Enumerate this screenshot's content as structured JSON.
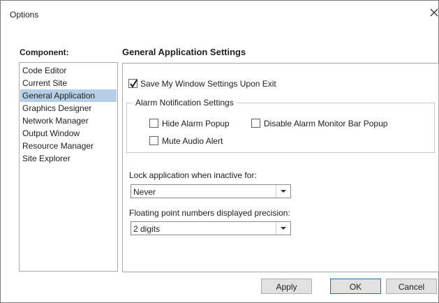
{
  "window": {
    "title": "Options"
  },
  "sidebar": {
    "label": "Component:",
    "items": [
      {
        "label": "Code Editor",
        "selected": false
      },
      {
        "label": "Current Site",
        "selected": false
      },
      {
        "label": "General Application",
        "selected": true
      },
      {
        "label": "Graphics Designer",
        "selected": false
      },
      {
        "label": "Network Manager",
        "selected": false
      },
      {
        "label": "Output Window",
        "selected": false
      },
      {
        "label": "Resource Manager",
        "selected": false
      },
      {
        "label": "Site Explorer",
        "selected": false
      }
    ]
  },
  "main": {
    "title": "General Application Settings",
    "save_settings": {
      "label": "Save My Window Settings Upon Exit",
      "checked": true
    },
    "alarm_group": {
      "legend": "Alarm Notification Settings",
      "hide_popup": {
        "label": "Hide Alarm Popup",
        "checked": false
      },
      "disable_monitor": {
        "label": "Disable Alarm Monitor Bar Popup",
        "checked": false
      },
      "mute_audio": {
        "label": "Mute Audio Alert",
        "checked": false
      }
    },
    "lock": {
      "label": "Lock application when inactive for:",
      "value": "Never"
    },
    "precision": {
      "label": "Floating point numbers displayed precision:",
      "value": "2 digits"
    }
  },
  "buttons": {
    "apply": "Apply",
    "ok": "OK",
    "cancel": "Cancel"
  },
  "icons": {
    "close": "close-icon",
    "check": "check-icon",
    "dropdown": "chevron-down-icon"
  }
}
